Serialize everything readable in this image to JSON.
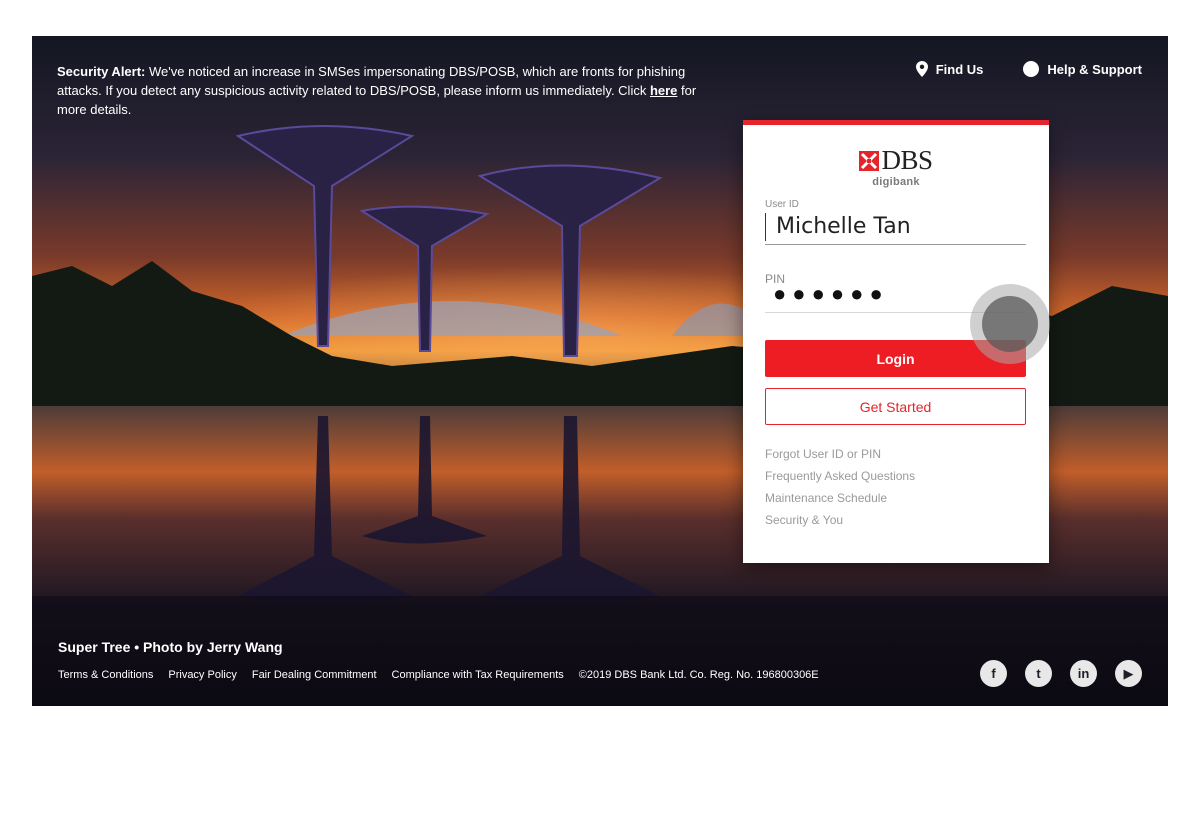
{
  "alert": {
    "prefix": "Security Alert:",
    "text": " We've noticed an increase in SMSes impersonating DBS/POSB, which are fronts for phishing attacks. If you detect any suspicious activity related to DBS/POSB, please inform us immediately. Click ",
    "link": "here",
    "suffix": " for more details."
  },
  "nav": {
    "find_us": "Find Us",
    "help": "Help & Support"
  },
  "login": {
    "brand": "DBS",
    "sub_brand": "digibank",
    "user_label": "User ID",
    "user_value": "Michelle Tan",
    "pin_label": "PIN",
    "pin_mask": "●●●●●●",
    "login_button": "Login",
    "start_button": "Get Started",
    "links": [
      "Forgot User ID or PIN",
      "Frequently Asked Questions",
      "Maintenance Schedule",
      "Security & You"
    ]
  },
  "photo_credit": "Super Tree  •  Photo by Jerry Wang",
  "footer": {
    "links": [
      "Terms & Conditions",
      "Privacy Policy",
      "Fair Dealing Commitment",
      "Compliance with Tax Requirements"
    ],
    "copyright": "©2019 DBS Bank Ltd. Co. Reg. No. 196800306E"
  },
  "social": [
    {
      "icon": "facebook-icon",
      "glyph": "f"
    },
    {
      "icon": "twitter-icon",
      "glyph": "t"
    },
    {
      "icon": "linkedin-icon",
      "glyph": "in"
    },
    {
      "icon": "youtube-icon",
      "glyph": "▶"
    }
  ],
  "colors": {
    "accent": "#ee1d23",
    "link_gray": "#9a9a9a"
  }
}
